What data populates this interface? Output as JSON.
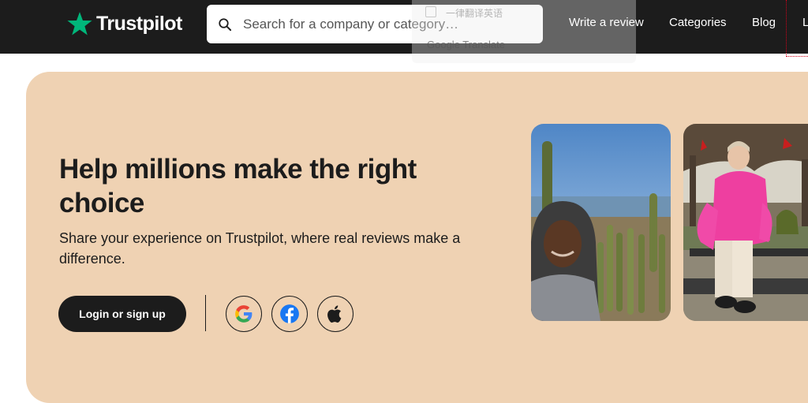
{
  "header": {
    "logo_text": "Trustpilot",
    "logo_icon": "star-icon",
    "search_placeholder": "Search for a company or category…",
    "nav": {
      "write_review": "Write a review",
      "categories": "Categories",
      "blog": "Blog",
      "login_partial": "L"
    }
  },
  "translate_popup": {
    "option_label": "一律翻译英语",
    "source_label": "Google Translate"
  },
  "hero": {
    "headline_line1": "Help millions make the right",
    "headline_line2": "choice",
    "subtitle": "Share your experience on Trustpilot, where real reviews make a difference.",
    "login_button": "Login or sign up",
    "social": [
      "google-icon",
      "facebook-icon",
      "apple-icon"
    ]
  },
  "colors": {
    "header_bg": "#1c1c1c",
    "hero_bg": "#efd2b3",
    "brand_green": "#00b67a",
    "button_bg": "#1c1c1c"
  }
}
